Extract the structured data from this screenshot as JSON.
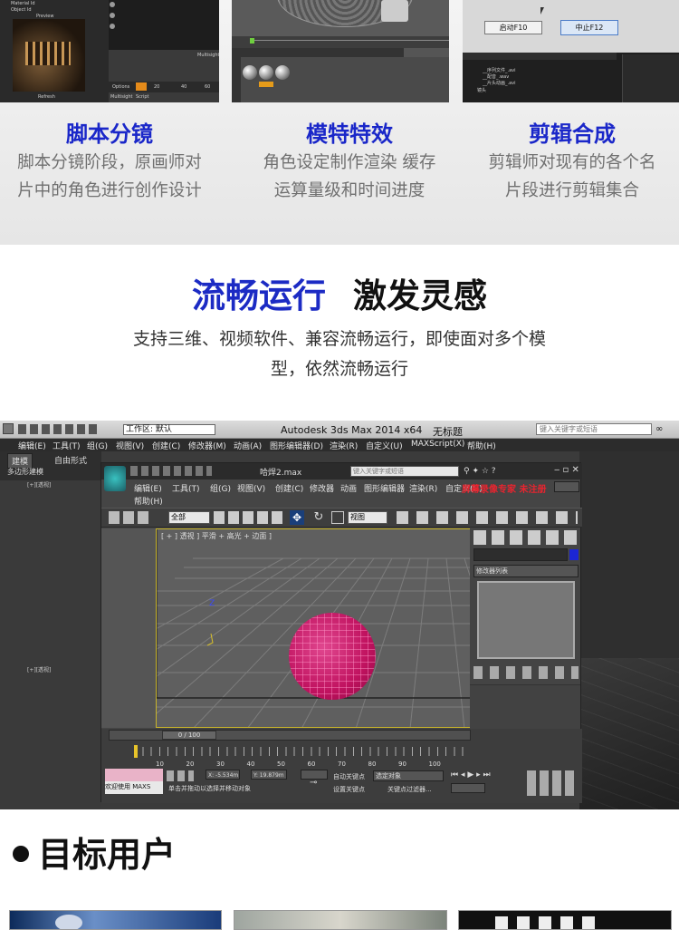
{
  "top": {
    "thumb1": {
      "label_a": "Material Id",
      "label_b": "Object Id",
      "preview": "Preview",
      "refresh": "Refresh",
      "options": "Options",
      "multisight": "Multisight",
      "script": "Script",
      "ticks": [
        "20",
        "40",
        "60"
      ]
    },
    "thumb3": {
      "start_btn": "启动F10",
      "stop_btn": "中止F12",
      "tracks": [
        "__序列文件_.avi",
        "__配音_.wav",
        "__片头动画_.avi",
        "镜头"
      ]
    }
  },
  "features": [
    {
      "title": "脚本分镜",
      "line1": "脚本分镜阶段，原画师对",
      "line2": "片中的角色进行创作设计"
    },
    {
      "title": "模特特效",
      "line1": "角色设定制作渲染 缓存",
      "line2": "运算量级和时间进度"
    },
    {
      "title": "剪辑合成",
      "line1": "剪辑师对现有的各个名",
      "line2": "片段进行剪辑集合"
    }
  ],
  "headline": {
    "blue": "流畅运行",
    "black": "激发灵感",
    "desc1": "支持三维、视频软件、兼容流畅运行，即使面对多个模",
    "desc2": "型，依然流畅运行"
  },
  "shot": {
    "workspace": "工作区: 默认",
    "app_title": "Autodesk 3ds Max  2014 x64",
    "doc_name": "无标题",
    "search_placeholder": "键入关键字或短语",
    "menu": [
      "编辑(E)",
      "工具(T)",
      "组(G)",
      "视图(V)",
      "创建(C)",
      "修改器(M)",
      "动画(A)",
      "图形编辑器(D)",
      "渲染(R)",
      "自定义(U)",
      "MAXScript(X)",
      "帮助(H)"
    ],
    "tabs": [
      "建模",
      "自由形式",
      "多边形建模"
    ],
    "bg_vp_label": "[+][透视]",
    "win_title": "哈焊2.max",
    "win_menu": [
      "编辑(E)",
      "工具(T)",
      "组(G)",
      "视图(V)",
      "创建(C)",
      "修改器",
      "动画",
      "图形编辑器",
      "渲染(R)",
      "自定义(U)",
      "帮助(H)"
    ],
    "watermark": "屏幕录像专家 未注册",
    "filter_all": "全部",
    "view_label": "视图",
    "viewport_label": "[ + ] 透视 ] 平滑 + 高光 + 边面 ]",
    "modifier_list": "修改器列表",
    "frame_counter": "0 / 100",
    "ticks": [
      "10",
      "20",
      "30",
      "40",
      "50",
      "60",
      "70",
      "80",
      "90",
      "100"
    ],
    "welcome": "欢迎使用 MAXS",
    "x_coord": "X: -5.534m",
    "y_coord": "Y: 19.879m",
    "status_prompt": "单击并拖动以选择并移动对象",
    "auto_key": "自动关键点",
    "set_key": "设置关键点",
    "selected_object": "选定对象",
    "key_filters": "关键点过滤器..."
  },
  "target": {
    "title": "目标用户"
  }
}
